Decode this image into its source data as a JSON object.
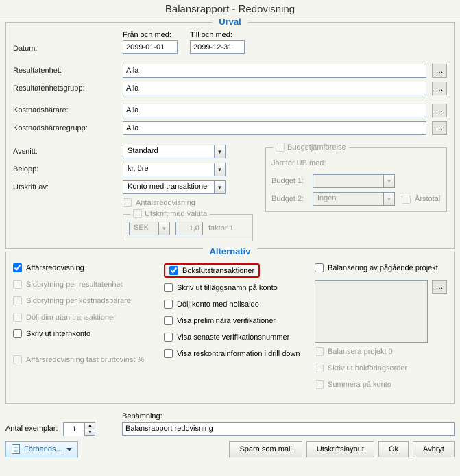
{
  "window_title": "Balansrapport - Redovisning",
  "urval": {
    "title": "Urval",
    "datum_label": "Datum:",
    "fran_label": "Från och med:",
    "fran_value": "2099-01-01",
    "till_label": "Till och med:",
    "till_value": "2099-12-31",
    "resultatenhet_label": "Resultatenhet:",
    "resultatenhet_value": "Alla",
    "resultatenhetsgrupp_label": "Resultatenhetsgrupp:",
    "resultatenhetsgrupp_value": "Alla",
    "kostnadsbarare_label": "Kostnadsbärare:",
    "kostnadsbarare_value": "Alla",
    "kostnadsbararegrupp_label": "Kostnadsbäraregrupp:",
    "kostnadsbararegrupp_value": "Alla",
    "avsnitt_label": "Avsnitt:",
    "avsnitt_value": "Standard",
    "belopp_label": "Belopp:",
    "belopp_value": "kr, öre",
    "utskrift_av_label": "Utskrift av:",
    "utskrift_av_value": "Konto med transaktioner",
    "antalsredovisning_label": "Antalsredovisning",
    "utskrift_valuta_label": "Utskrift med valuta",
    "valuta_value": "SEK",
    "faktor_value": "1,0",
    "faktor_label": "faktor 1",
    "budget_title": "Budgetjämförelse",
    "jamfor_label": "Jämför UB med:",
    "budget1_label": "Budget 1:",
    "budget1_value": "",
    "budget2_label": "Budget 2:",
    "budget2_value": "Ingen",
    "arstotal_label": "Årstotal"
  },
  "alternativ": {
    "title": "Alternativ",
    "col1": {
      "affarsredovisning": "Affärsredovisning",
      "sidbrytning_resultatenhet": "Sidbrytning per resultatenhet",
      "sidbrytning_kostnadsbarare": "Sidbrytning per kostnadsbärare",
      "dolj_dim_utan_transaktioner": "Dölj dim utan transaktioner",
      "skriv_ut_internkonto": "Skriv ut internkonto",
      "affarsredovisning_fast": "Affärsredovisning fast bruttovinst %"
    },
    "col2": {
      "bokslutstransaktioner": "Bokslutstransaktioner",
      "skriv_ut_tillaggsnamn": "Skriv ut tilläggsnamn på konto",
      "dolj_nollsaldo": "Dölj konto med nollsaldo",
      "visa_preliminara": "Visa preliminära verifikationer",
      "visa_senaste_verifnr": "Visa senaste verifikationsnummer",
      "visa_reskontra": "Visa reskontrainformation i drill down"
    },
    "col3": {
      "balansering_pagaende": "Balansering av pågående projekt",
      "balansera_projekt0": "Balansera projekt 0",
      "skriv_ut_bokforingsorder": "Skriv ut bokföringsorder",
      "summera_pa_konto": "Summera på konto"
    }
  },
  "bottom": {
    "antal_exemplar_label": "Antal exemplar:",
    "antal_exemplar_value": "1",
    "benamning_label": "Benämning:",
    "benamning_value": "Balansrapport redovisning"
  },
  "footer": {
    "forhands": "Förhands...",
    "spara_mall": "Spara som mall",
    "utskriftslayout": "Utskriftslayout",
    "ok": "Ok",
    "avbryt": "Avbryt"
  }
}
